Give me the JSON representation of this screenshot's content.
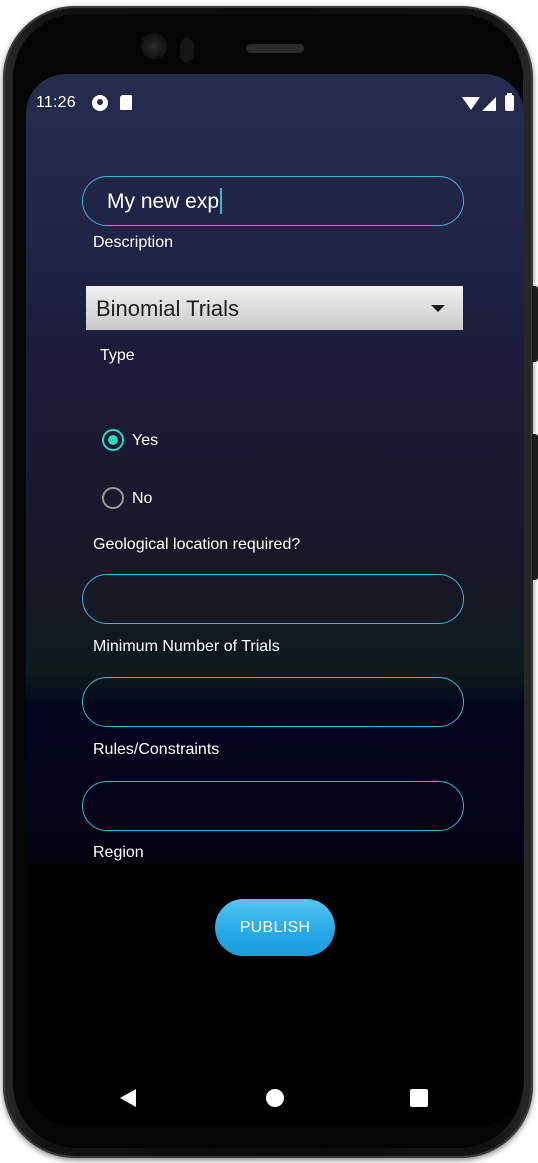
{
  "status_bar": {
    "time": "11:26",
    "icons": [
      "app-notification-icon",
      "sd-card-icon",
      "wifi-icon",
      "cell-signal-icon",
      "battery-icon"
    ]
  },
  "form": {
    "description": {
      "value": "My new exp",
      "label": "Description"
    },
    "type": {
      "selected": "Binomial Trials",
      "label": "Type"
    },
    "geo_location": {
      "options": [
        "Yes",
        "No"
      ],
      "selected": "Yes",
      "label": "Geological location required?"
    },
    "min_trials": {
      "value": "",
      "label": "Minimum Number of Trials"
    },
    "rules": {
      "value": "",
      "label": "Rules/Constraints"
    },
    "region": {
      "value": "",
      "label": "Region"
    },
    "publish_label": "PUBLISH"
  },
  "nav_bar": {
    "icons": [
      "back-icon",
      "home-icon",
      "recents-icon"
    ]
  },
  "colors": {
    "accent_border": "#37b6d8",
    "radio_active": "#2fd6c0",
    "publish_button": "#2aa9e8"
  }
}
